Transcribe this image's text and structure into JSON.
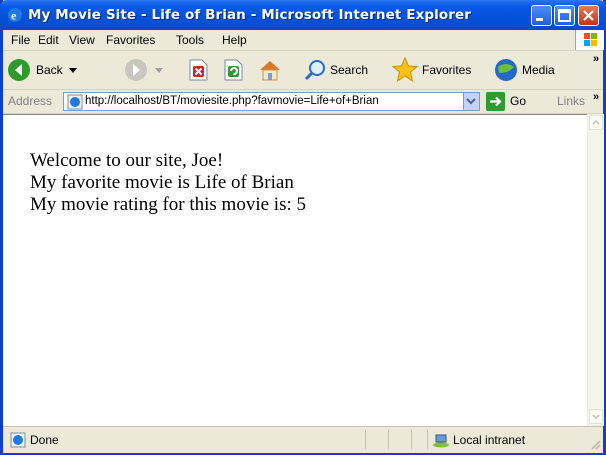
{
  "window": {
    "title": "My Movie Site - Life of Brian - Microsoft Internet Explorer"
  },
  "menu": {
    "items": [
      "File",
      "Edit",
      "View",
      "Favorites",
      "Tools",
      "Help"
    ]
  },
  "toolbar": {
    "back_label": "Back",
    "search_label": "Search",
    "favorites_label": "Favorites",
    "media_label": "Media"
  },
  "address": {
    "label": "Address",
    "url": "http://localhost/BT/moviesite.php?favmovie=Life+of+Brian",
    "go_label": "Go",
    "links_label": "Links"
  },
  "page": {
    "line1": "Welcome to our site, Joe!",
    "line2": "My favorite movie is Life of Brian",
    "line3": "My movie rating for this movie is: 5"
  },
  "status": {
    "text": "Done",
    "zone": "Local intranet"
  },
  "colors": {
    "titlebar": "#0453dc",
    "chrome": "#ece9d8"
  }
}
